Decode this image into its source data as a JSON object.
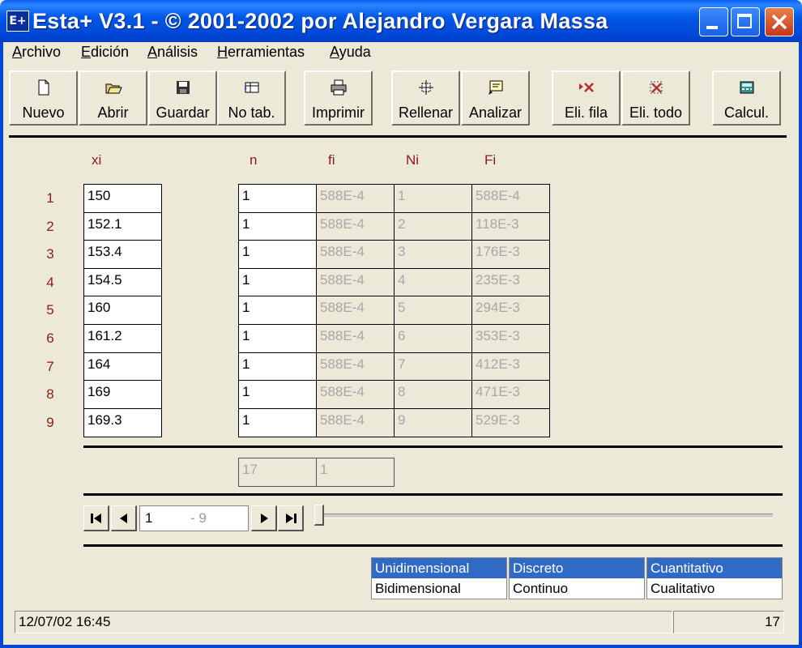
{
  "window": {
    "title": "Esta+ V3.1 - © 2001-2002 por Alejandro Vergara Massa",
    "icon_label": "E+"
  },
  "menu": [
    "Archivo",
    "Edición",
    "Análisis",
    "Herramientas",
    "Ayuda"
  ],
  "toolbar": {
    "nuevo": "Nuevo",
    "abrir": "Abrir",
    "guardar": "Guardar",
    "notab": "No tab.",
    "imprimir": "Imprimir",
    "rellenar": "Rellenar",
    "analizar": "Analizar",
    "elifila": "Eli. fila",
    "elitodo": "Eli. todo",
    "calcul": "Calcul."
  },
  "columns": {
    "xi": "xi",
    "n": "n",
    "fi": "fi",
    "Ni": "Ni",
    "Fi": "Fi"
  },
  "rows": [
    {
      "num": "1",
      "xi": "150",
      "n": "1",
      "fi": "588E-4",
      "Ni": "1",
      "Fi": "588E-4"
    },
    {
      "num": "2",
      "xi": "152.1",
      "n": "1",
      "fi": "588E-4",
      "Ni": "2",
      "Fi": "118E-3"
    },
    {
      "num": "3",
      "xi": "153.4",
      "n": "1",
      "fi": "588E-4",
      "Ni": "3",
      "Fi": "176E-3"
    },
    {
      "num": "4",
      "xi": "154.5",
      "n": "1",
      "fi": "588E-4",
      "Ni": "4",
      "Fi": "235E-3"
    },
    {
      "num": "5",
      "xi": "160",
      "n": "1",
      "fi": "588E-4",
      "Ni": "5",
      "Fi": "294E-3"
    },
    {
      "num": "6",
      "xi": "161.2",
      "n": "1",
      "fi": "588E-4",
      "Ni": "6",
      "Fi": "353E-3"
    },
    {
      "num": "7",
      "xi": "164",
      "n": "1",
      "fi": "588E-4",
      "Ni": "7",
      "Fi": "412E-3"
    },
    {
      "num": "8",
      "xi": "169",
      "n": "1",
      "fi": "588E-4",
      "Ni": "8",
      "Fi": "471E-3"
    },
    {
      "num": "9",
      "xi": "169.3",
      "n": "1",
      "fi": "588E-4",
      "Ni": "9",
      "Fi": "529E-3"
    }
  ],
  "totals": {
    "n": "17",
    "fi": "1"
  },
  "navigator": {
    "from": "1",
    "to": "- 9"
  },
  "options": {
    "dimension": [
      "Unidimensional",
      "Bidimensional"
    ],
    "variable": [
      "Discreto",
      "Continuo"
    ],
    "type": [
      "Cuantitativo",
      "Cualitativo"
    ]
  },
  "status": {
    "datetime": "12/07/02 16:45",
    "count": "17"
  },
  "colors": {
    "accent": "#316AC5",
    "label": "#8B1A1A",
    "titlebar": "#0046D5"
  }
}
